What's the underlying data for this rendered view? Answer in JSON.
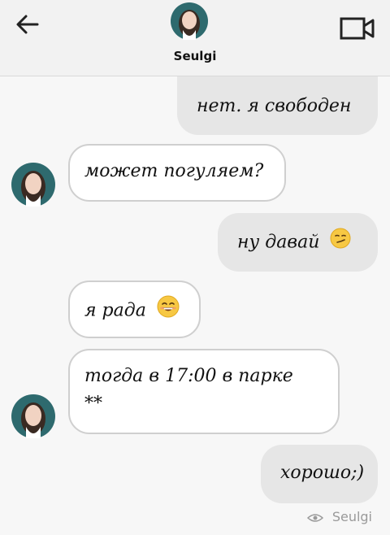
{
  "header": {
    "contact_name": "Seulgi"
  },
  "messages": [
    {
      "direction": "outgoing",
      "text": "нет. я свободен"
    },
    {
      "direction": "incoming",
      "text": "может погуляем?"
    },
    {
      "direction": "outgoing",
      "text": "ну давай",
      "emoji": "smirk-emoji"
    },
    {
      "direction": "incoming",
      "text": "я рада",
      "emoji": "smiling-emoji"
    },
    {
      "direction": "incoming",
      "text_line1": "тогда в 17:00 в парке",
      "text_line2": "**"
    },
    {
      "direction": "outgoing",
      "text": "хорошо;)"
    }
  ],
  "seen_indicator": {
    "icon": "eye-icon",
    "name": "Seulgi"
  }
}
